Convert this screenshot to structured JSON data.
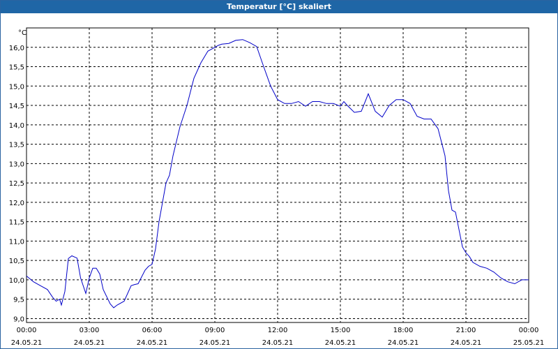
{
  "window": {
    "title": "Temperatur [°C] skaliert"
  },
  "colors": {
    "titlebar": "#1f66a6",
    "line": "#0000c8",
    "grid": "#000000"
  },
  "chart_data": {
    "type": "line",
    "title": "Temperatur [°C] skaliert",
    "ylabel": "°C",
    "xlabel": "",
    "grid": true,
    "ylim": [
      8.9,
      16.5
    ],
    "xlim": [
      "24.05.21 00:00",
      "25.05.21 00:00"
    ],
    "y_ticks": [
      "9,0",
      "9,5",
      "10,0",
      "10,5",
      "11,0",
      "11,5",
      "12,0",
      "12,5",
      "13,0",
      "13,5",
      "14,0",
      "14,5",
      "15,0",
      "15,5",
      "16,0"
    ],
    "x_ticks": [
      {
        "time": "00:00",
        "date": "24.05.21"
      },
      {
        "time": "03:00",
        "date": "24.05.21"
      },
      {
        "time": "06:00",
        "date": "24.05.21"
      },
      {
        "time": "09:00",
        "date": "24.05.21"
      },
      {
        "time": "12:00",
        "date": "24.05.21"
      },
      {
        "time": "15:00",
        "date": "24.05.21"
      },
      {
        "time": "18:00",
        "date": "24.05.21"
      },
      {
        "time": "21:00",
        "date": "24.05.21"
      },
      {
        "time": "00:00",
        "date": "25.05.21"
      }
    ],
    "series": [
      {
        "x": [
          "24.05.21 00:00",
          "24.05.21 00:20",
          "24.05.21 00:40",
          "24.05.21 01:00",
          "24.05.21 01:15",
          "24.05.21 01:25",
          "24.05.21 01:35",
          "24.05.21 01:40",
          "24.05.21 01:50",
          "24.05.21 02:00",
          "24.05.21 02:10",
          "24.05.21 02:20",
          "24.05.21 02:25",
          "24.05.21 02:35",
          "24.05.21 02:50",
          "24.05.21 03:00",
          "24.05.21 03:10",
          "24.05.21 03:20",
          "24.05.21 03:30",
          "24.05.21 03:40",
          "24.05.21 04:00",
          "24.05.21 04:10",
          "24.05.21 04:20",
          "24.05.21 04:40",
          "24.05.21 05:00",
          "24.05.21 05:10",
          "24.05.21 05:20",
          "24.05.21 05:40",
          "24.05.21 05:50",
          "24.05.21 06:00",
          "24.05.21 06:10",
          "24.05.21 06:20",
          "24.05.21 06:30",
          "24.05.21 06:40",
          "24.05.21 06:50",
          "24.05.21 07:00",
          "24.05.21 07:20",
          "24.05.21 07:40",
          "24.05.21 08:00",
          "24.05.21 08:20",
          "24.05.21 08:40",
          "24.05.21 09:00",
          "24.05.21 09:10",
          "24.05.21 09:20",
          "24.05.21 09:40",
          "24.05.21 10:00",
          "24.05.21 10:20",
          "24.05.21 10:40",
          "24.05.21 11:00",
          "24.05.21 11:20",
          "24.05.21 11:40",
          "24.05.21 12:00",
          "24.05.21 12:20",
          "24.05.21 12:40",
          "24.05.21 13:00",
          "24.05.21 13:20",
          "24.05.21 13:40",
          "24.05.21 14:00",
          "24.05.21 14:20",
          "24.05.21 14:40",
          "24.05.21 15:00",
          "24.05.21 15:10",
          "24.05.21 15:20",
          "24.05.21 15:40",
          "24.05.21 16:00",
          "24.05.21 16:20",
          "24.05.21 16:40",
          "24.05.21 17:00",
          "24.05.21 17:20",
          "24.05.21 17:40",
          "24.05.21 18:00",
          "24.05.21 18:20",
          "24.05.21 18:40",
          "24.05.21 19:00",
          "24.05.21 19:20",
          "24.05.21 19:40",
          "24.05.21 20:00",
          "24.05.21 20:10",
          "24.05.21 20:20",
          "24.05.21 20:30",
          "24.05.21 20:40",
          "24.05.21 20:50",
          "24.05.21 21:00",
          "24.05.21 21:10",
          "24.05.21 21:20",
          "24.05.21 21:40",
          "24.05.21 22:00",
          "24.05.21 22:20",
          "24.05.21 22:40",
          "24.05.21 23:00",
          "24.05.21 23:20",
          "24.05.21 23:40",
          "25.05.21 00:00"
        ],
        "y": [
          10.1,
          9.95,
          9.85,
          9.75,
          9.55,
          9.45,
          9.5,
          9.35,
          9.7,
          10.55,
          10.62,
          10.58,
          10.56,
          10.05,
          9.65,
          10.05,
          10.3,
          10.3,
          10.15,
          9.75,
          9.38,
          9.28,
          9.35,
          9.45,
          9.85,
          9.88,
          9.9,
          10.25,
          10.35,
          10.4,
          10.8,
          11.5,
          12.0,
          12.5,
          12.7,
          13.2,
          13.95,
          14.5,
          15.2,
          15.6,
          15.9,
          16.0,
          16.05,
          16.08,
          16.1,
          16.18,
          16.2,
          16.12,
          16.02,
          15.5,
          15.0,
          14.65,
          14.55,
          14.55,
          14.6,
          14.48,
          14.6,
          14.6,
          14.55,
          14.55,
          14.48,
          14.6,
          14.5,
          14.32,
          14.35,
          14.8,
          14.35,
          14.2,
          14.5,
          14.65,
          14.65,
          14.55,
          14.22,
          14.15,
          14.15,
          13.9,
          13.2,
          12.3,
          11.8,
          11.75,
          11.3,
          10.85,
          10.7,
          10.6,
          10.45,
          10.35,
          10.3,
          10.2,
          10.05,
          9.95,
          9.9,
          10.0,
          10.0
        ]
      }
    ]
  }
}
